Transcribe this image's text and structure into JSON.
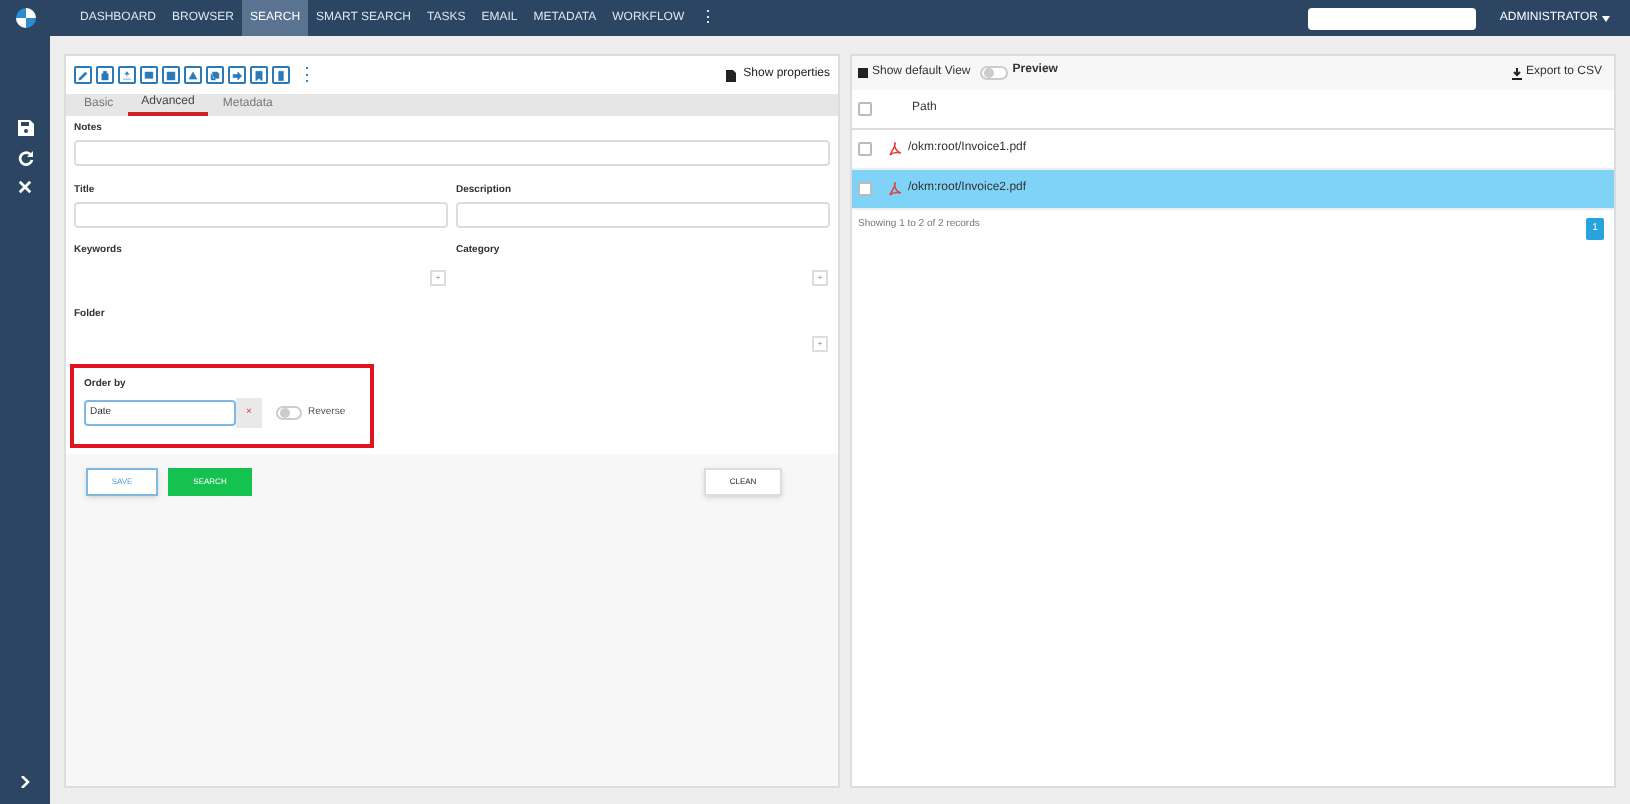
{
  "nav": {
    "items": [
      {
        "label": "DASHBOARD",
        "selected": false
      },
      {
        "label": "BROWSER",
        "selected": false
      },
      {
        "label": "SEARCH",
        "selected": true
      },
      {
        "label": "SMART SEARCH",
        "selected": false
      },
      {
        "label": "TASKS",
        "selected": false
      },
      {
        "label": "EMAIL",
        "selected": false
      },
      {
        "label": "METADATA",
        "selected": false
      },
      {
        "label": "WORKFLOW",
        "selected": false
      }
    ],
    "more": "⋮",
    "user": "ADMINISTRATOR"
  },
  "toolbar": {
    "more": "⋮",
    "show_properties": "Show properties"
  },
  "tabs": [
    {
      "label": "Basic",
      "selected": false
    },
    {
      "label": "Advanced",
      "selected": true
    },
    {
      "label": "Metadata",
      "selected": false
    }
  ],
  "form": {
    "notes": "Notes",
    "title": "Title",
    "description": "Description",
    "keywords": "Keywords",
    "category": "Category",
    "folder": "Folder",
    "add": "+"
  },
  "order_by": {
    "label": "Order by",
    "value": "Date",
    "clear": "×",
    "reverse_label": "Reverse",
    "reverse_on": false,
    "highlighted": true
  },
  "buttons": {
    "save": "SAVE",
    "search": "SEARCH",
    "clean": "CLEAN"
  },
  "results": {
    "show_default_view": "Show default View",
    "preview_label": "Preview",
    "preview_on": false,
    "export": "Export to CSV",
    "column": "Path",
    "all_checked": false,
    "rows": [
      {
        "path": "/okm:root/Invoice1.pdf",
        "selected": false,
        "checked": false
      },
      {
        "path": "/okm:root/Invoice2.pdf",
        "selected": true,
        "checked": false
      }
    ],
    "footer": "Showing 1 to 2 of 2 records",
    "page": "1"
  }
}
